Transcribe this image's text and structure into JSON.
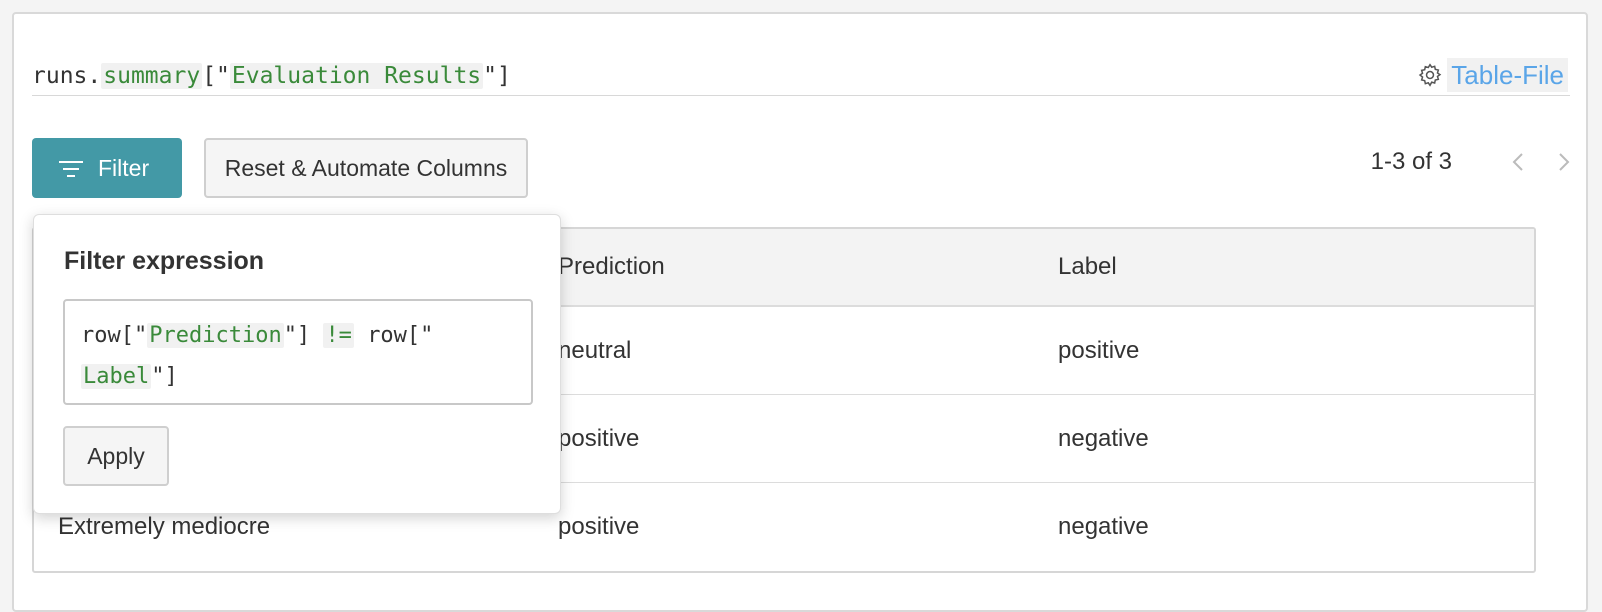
{
  "expression": {
    "prefix": "runs.",
    "method": "summary",
    "open": "[\"",
    "key": "Evaluation Results",
    "close": "\"]"
  },
  "panel_type": {
    "label": "Table-File",
    "icon": "gear-icon"
  },
  "toolbar": {
    "filter_label": "Filter",
    "filter_icon": "filter-lines-icon",
    "reset_label": "Reset & Automate Columns"
  },
  "pagination": {
    "text": "1-3 of 3",
    "prev_icon": "chevron-left-icon",
    "next_icon": "chevron-right-icon"
  },
  "table": {
    "columns": [
      "",
      "Prediction",
      "Label"
    ],
    "rows": [
      [
        "",
        "neutral",
        "positive"
      ],
      [
        "",
        "positive",
        "negative"
      ],
      [
        "Extremely mediocre",
        "positive",
        "negative"
      ]
    ]
  },
  "filter_popover": {
    "title": "Filter expression",
    "expr": {
      "t1": "row[\"",
      "t2": "Prediction",
      "t3": "\"]",
      "t4": "!=",
      "t5": "row[\"",
      "t6": "Label",
      "t7": "\"]"
    },
    "apply_label": "Apply"
  },
  "colors": {
    "filter_button": "#4399a6",
    "token_green": "#3a8a3a",
    "link_blue": "#5aa5e8"
  }
}
